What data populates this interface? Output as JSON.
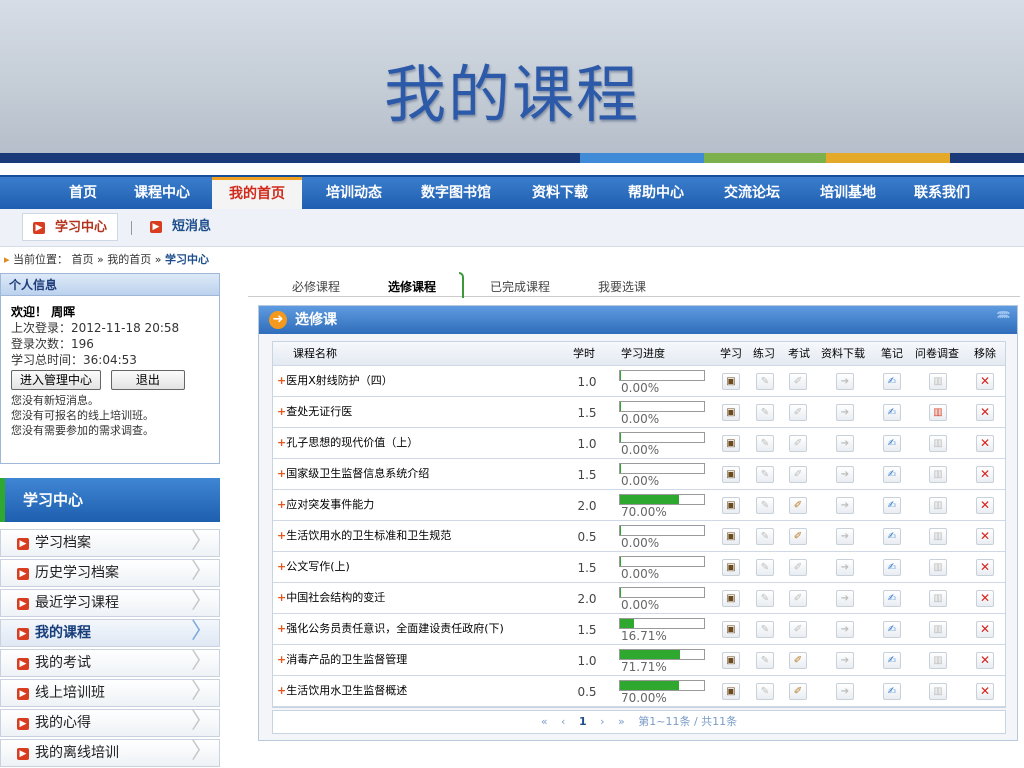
{
  "banner": {
    "title": "我的课程"
  },
  "nav": [
    "首页",
    "课程中心",
    "我的首页",
    "培训动态",
    "数字图书馆",
    "资料下载",
    "帮助中心",
    "交流论坛",
    "培训基地",
    "联系我们"
  ],
  "nav_active": "我的首页",
  "subnav": {
    "study_center": "学习中心",
    "messages": "短消息"
  },
  "breadcrumb": {
    "prefix": "当前位置：",
    "home": "首页",
    "sep": "»",
    "mypage": "我的首页",
    "current": "学习中心"
  },
  "profile": {
    "title": "个人信息",
    "welcome": "欢迎！ 周晖",
    "last_login": "上次登录：2012-11-18 20:58",
    "login_count": "登录次数：196",
    "total_time": "学习总时间：36:04:53",
    "manage_btn": "进入管理中心",
    "logout_btn": "退出",
    "msgs": [
      "您没有新短消息。",
      "您没有可报名的线上培训班。",
      "您没有需要参加的需求调查。"
    ]
  },
  "left_menu": {
    "title": "学习中心",
    "items": [
      "学习档案",
      "历史学习档案",
      "最近学习课程",
      "我的课程",
      "我的考试",
      "线上培训班",
      "我的心得",
      "我的离线培训"
    ],
    "active": "我的课程"
  },
  "tabs": [
    "必修课程",
    "选修课程",
    "已完成课程",
    "我要选课"
  ],
  "tab_active": "选修课程",
  "panel": {
    "title": "选修课"
  },
  "table": {
    "headers": [
      "课程名称",
      "学时",
      "学习进度",
      "学习",
      "练习",
      "考试",
      "资料下载",
      "笔记",
      "问卷调查",
      "移除"
    ],
    "rows": [
      {
        "name": "医用X射线防护（四）",
        "hours": "1.0",
        "progress": 0.0,
        "progress_label": "0.00%",
        "exam": false,
        "survey": false
      },
      {
        "name": "查处无证行医",
        "hours": "1.5",
        "progress": 0.0,
        "progress_label": "0.00%",
        "exam": false,
        "survey": true
      },
      {
        "name": "孔子思想的现代价值（上）",
        "hours": "1.0",
        "progress": 0.0,
        "progress_label": "0.00%",
        "exam": false,
        "survey": false
      },
      {
        "name": "国家级卫生监督信息系统介绍",
        "hours": "1.5",
        "progress": 0.0,
        "progress_label": "0.00%",
        "exam": false,
        "survey": false
      },
      {
        "name": "应对突发事件能力",
        "hours": "2.0",
        "progress": 70.0,
        "progress_label": "70.00%",
        "exam": true,
        "survey": false
      },
      {
        "name": "生活饮用水的卫生标准和卫生规范",
        "hours": "0.5",
        "progress": 0.0,
        "progress_label": "0.00%",
        "exam": true,
        "survey": false
      },
      {
        "name": "公文写作(上)",
        "hours": "1.5",
        "progress": 0.0,
        "progress_label": "0.00%",
        "exam": false,
        "survey": false
      },
      {
        "name": "中国社会结构的变迁",
        "hours": "2.0",
        "progress": 0.0,
        "progress_label": "0.00%",
        "exam": false,
        "survey": false
      },
      {
        "name": "强化公务员责任意识，全面建设责任政府(下)",
        "hours": "1.5",
        "progress": 16.71,
        "progress_label": "16.71%",
        "exam": false,
        "survey": false
      },
      {
        "name": "消毒产品的卫生监督管理",
        "hours": "1.0",
        "progress": 71.71,
        "progress_label": "71.71%",
        "exam": true,
        "survey": false
      },
      {
        "name": "生活饮用水卫生监督概述",
        "hours": "0.5",
        "progress": 70.0,
        "progress_label": "70.00%",
        "exam": true,
        "survey": false
      }
    ]
  },
  "pager": {
    "first": "«",
    "prev": "‹",
    "current": "1",
    "next": "›",
    "last": "»",
    "summary": "第1~11条 / 共11条"
  },
  "colors": {
    "nav_blue": "#1f5eb0",
    "accent_red": "#d12b1c",
    "progress_green": "#2ea82e"
  }
}
